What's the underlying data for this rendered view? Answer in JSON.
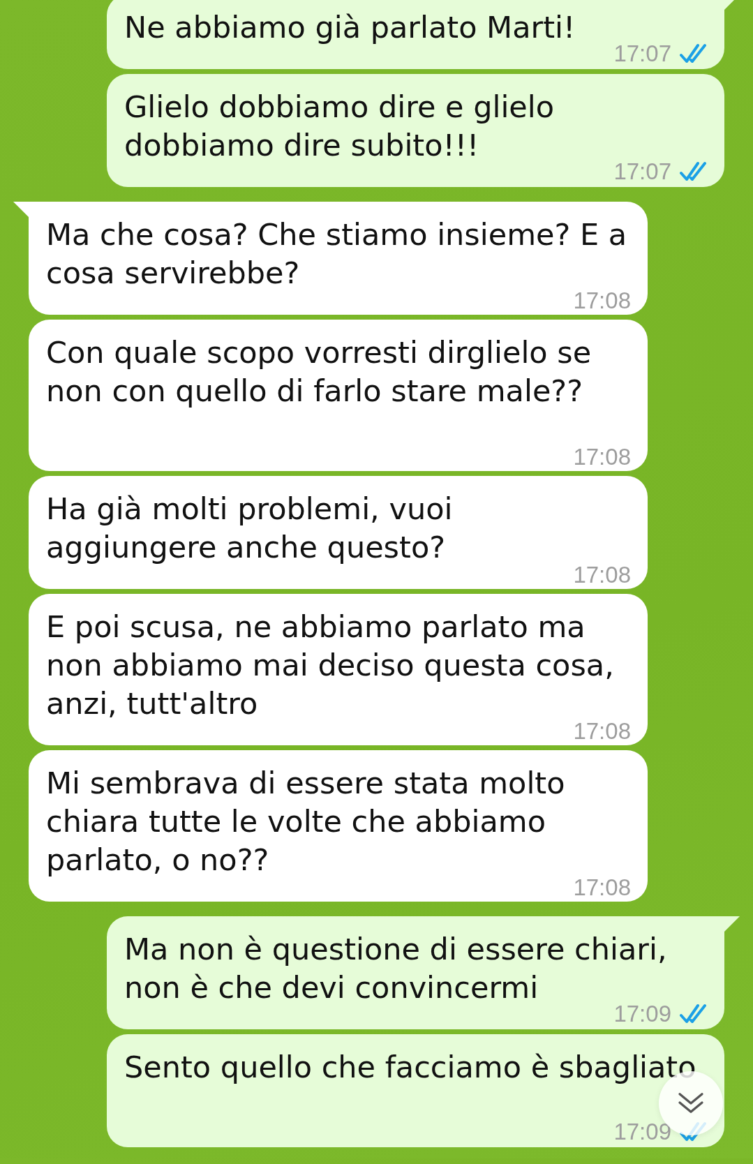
{
  "messages": [
    {
      "kind": "sent",
      "tail": true,
      "text": "Ne abbiamo già parlato Marti!",
      "time": "17:07",
      "read": true
    },
    {
      "kind": "sent",
      "tail": false,
      "text": "Glielo dobbiamo dire e glielo dobbiamo dire subito!!!",
      "time": "17:07",
      "read": true
    },
    {
      "kind": "received",
      "tail": true,
      "text": "Ma che cosa? Che stiamo insieme? E a cosa servirebbe?",
      "time": "17:08"
    },
    {
      "kind": "received",
      "tail": false,
      "text": "Con quale scopo vorresti dirglielo se non con quello di farlo stare male??",
      "time": "17:08"
    },
    {
      "kind": "received",
      "tail": false,
      "text": "Ha già molti problemi, vuoi aggiungere anche questo?",
      "time": "17:08"
    },
    {
      "kind": "received",
      "tail": false,
      "text": "E poi scusa, ne abbiamo parlato ma non abbiamo mai deciso questa cosa, anzi, tutt'altro",
      "time": "17:08"
    },
    {
      "kind": "received",
      "tail": false,
      "text": "Mi sembrava di essere stata molto chiara tutte le volte che abbiamo parlato, o no??",
      "time": "17:08"
    },
    {
      "kind": "sent",
      "tail": true,
      "text": "Ma non è questione di essere chiari, non è che devi convincermi",
      "time": "17:09",
      "read": true
    },
    {
      "kind": "sent",
      "tail": false,
      "text": "Sento quello che facciamo è sbagliato",
      "time": "17:09",
      "read": true
    }
  ],
  "scroll_down_button": {
    "kind": "scroll"
  }
}
